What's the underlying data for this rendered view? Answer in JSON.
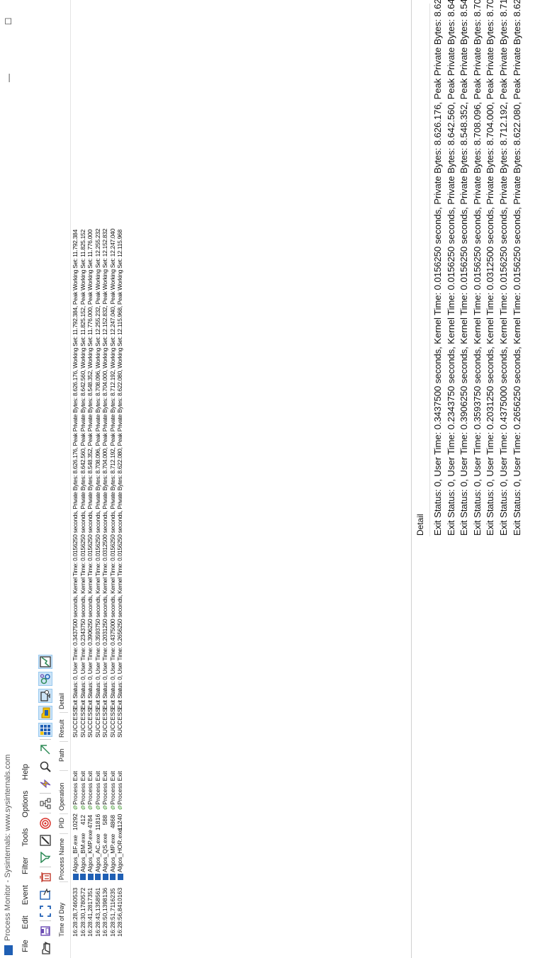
{
  "window": {
    "title": "Process Monitor - Sysinternals: www.sysinternals.com",
    "minimize_glyph": "—",
    "maximize_glyph": "☐"
  },
  "menu": [
    "File",
    "Edit",
    "Event",
    "Filter",
    "Tools",
    "Options",
    "Help"
  ],
  "toolbar": [
    {
      "name": "open-icon",
      "active": false
    },
    {
      "name": "save-icon",
      "active": false
    },
    {
      "name": "capture-icon",
      "active": false
    },
    {
      "name": "autoscroll-icon",
      "active": false
    },
    {
      "name": "clear-icon",
      "active": false
    },
    {
      "name": "filter-icon",
      "active": false
    },
    {
      "name": "highlight-icon",
      "active": false
    },
    {
      "name": "target-icon",
      "active": false
    },
    {
      "name": "process-tree-icon",
      "active": false
    },
    {
      "name": "lightning-icon",
      "active": false
    },
    {
      "name": "find-icon",
      "active": false
    },
    {
      "name": "jump-icon",
      "active": false
    },
    {
      "name": "registry-activity-icon",
      "active": true
    },
    {
      "name": "filesystem-activity-icon",
      "active": true
    },
    {
      "name": "network-activity-icon",
      "active": true
    },
    {
      "name": "process-thread-activity-icon",
      "active": true
    },
    {
      "name": "profiling-events-icon",
      "active": true
    }
  ],
  "table": {
    "columns": [
      "Time of Day",
      "Process Name",
      "PID",
      "Operation",
      "Path",
      "Result",
      "Detail"
    ],
    "rows": [
      {
        "time": "16:28:28,7460533",
        "process": "Algos_BF.exe",
        "pid": "10292",
        "operation": "Process Exit",
        "path": "",
        "result": "SUCCESS",
        "detail": "Exit Status: 0, User Time: 0.3437500 seconds, Kernel Time: 0.0156250 seconds, Private Bytes: 8.626.176, Peak Private Bytes: 8.626.176, Working Set: 11.792.384, Peak Working Set: 11.792.384"
      },
      {
        "time": "16:28:30,1780572",
        "process": "Algos_BM.exe",
        "pid": "412",
        "operation": "Process Exit",
        "path": "",
        "result": "SUCCESS",
        "detail": "Exit Status: 0, User Time: 0.2343750 seconds, Kernel Time: 0.0156250 seconds, Private Bytes: 8.642.560, Peak Private Bytes: 8.642.560, Working Set: 11.825.152, Peak Working Set: 11.825.152"
      },
      {
        "time": "16:28:41,2817351",
        "process": "Algos_KMP.exe",
        "pid": "4784",
        "operation": "Process Exit",
        "path": "",
        "result": "SUCCESS",
        "detail": "Exit Status: 0, User Time: 0.3906250 seconds, Kernel Time: 0.0156250 seconds, Private Bytes: 8.548.352, Peak Private Bytes: 8.548.352, Working Set: 11.776.000, Peak Working Set: 11.776.000"
      },
      {
        "time": "16:28:43,1358561",
        "process": "Algos_AC.exe",
        "pid": "11816",
        "operation": "Process Exit",
        "path": "",
        "result": "SUCCESS",
        "detail": "Exit Status: 0, User Time: 0.3593750 seconds, Kernel Time: 0.0156250 seconds, Private Bytes: 8.708.096, Peak Private Bytes: 8.708.096, Working Set: 12.255.232, Peak Working Set: 12.255.232"
      },
      {
        "time": "16:28:50,1398136",
        "process": "Algos_QS.exe",
        "pid": "588",
        "operation": "Process Exit",
        "path": "",
        "result": "SUCCESS",
        "detail": "Exit Status: 0, User Time: 0.2031250 seconds, Kernel Time: 0.0312500 seconds, Private Bytes: 8.704.000, Peak Private Bytes: 8.704.000, Working Set: 12.152.832, Peak Working Set: 12.152.832"
      },
      {
        "time": "16:28:51,7116235",
        "process": "Algos_MP.exe",
        "pid": "4868",
        "operation": "Process Exit",
        "path": "",
        "result": "SUCCESS",
        "detail": "Exit Status: 0, User Time: 0.4375000 seconds, Kernel Time: 0.0156250 seconds, Private Bytes: 8.712.192, Peak Private Bytes: 8.712.192, Working Set: 12.247.040, Peak Working Set: 12.247.040"
      },
      {
        "time": "16:28:56,8410163",
        "process": "Algos_HOR.exe",
        "pid": "11240",
        "operation": "Process Exit",
        "path": "",
        "result": "SUCCESS",
        "detail": "Exit Status: 0, User Time: 0.2656250 seconds, Kernel Time: 0.0156250 seconds, Private Bytes: 8.622.080, Peak Private Bytes: 8.622.080, Working Set: 12.115.968, Peak Working Set: 12.115.968"
      }
    ]
  },
  "detail_pane": {
    "title": "Detail"
  },
  "colors": {
    "accent": "#1f5fb4",
    "toolbar_active_bg": "#cce4f7",
    "toolbar_active_border": "#99c9ef",
    "gear": "#4a9b3a"
  }
}
